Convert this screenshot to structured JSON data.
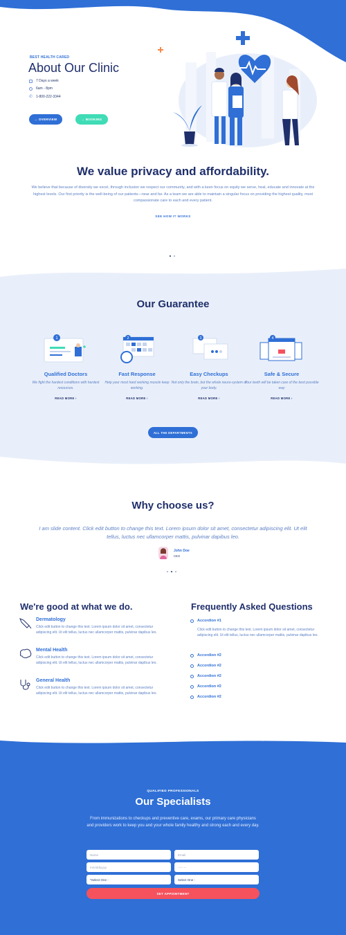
{
  "hero": {
    "eyebrow": "BEST HEALTH CARED",
    "title": "About Our Clinic",
    "info": [
      "7 Days a week",
      "6am - 8pm",
      "1-800-222-3344"
    ],
    "buttons": {
      "overview": "→ OVERVIEW",
      "booking": "→ BOOKING"
    }
  },
  "privacy": {
    "title": "We value privacy and affordability.",
    "text": "We believe that because of diversity we excel, through inclusion we respect our community, and with a keen focus on equity we serve, heal, educate and innovate at the highest levels. Our first priority is the well-being of our patients—near and far. As a team we are able to maintain a singular focus on providing the highest quality, most compassionate care to each and every patient.",
    "link": "SEE HOW IT WORKS"
  },
  "guarantee": {
    "title": "Our Guarantee",
    "cards": [
      {
        "num": "1",
        "title": "Qualified Doctors",
        "desc": "We fight the hardest conditions with hardest resources.",
        "more": "READ MORE ›"
      },
      {
        "num": "2",
        "title": "Fast Response",
        "desc": "Help your most hard working muscle keep working.",
        "more": "READ MORE ›"
      },
      {
        "num": "3",
        "title": "Easy Checkups",
        "desc": "Not only the brain, but the whole neuro-system of your body.",
        "more": "READ MORE ›"
      },
      {
        "num": "4",
        "title": "Safe & Secure",
        "desc": "Your teeth will be taken care of the best possible way",
        "more": "READ MORE ›"
      }
    ],
    "button": "ALL THE DEPARTMENTS"
  },
  "why": {
    "title": "Why choose us?",
    "quote": "I am slide content. Click edit button to change this text. Lorem ipsum dolor sit amet, consectetur adipiscing elit. Ut elit tellus, luctus nec ullamcorper mattis, pulvinar dapibus leo.",
    "person": {
      "name": "John Doe",
      "role": "CEO"
    }
  },
  "services": {
    "title": "We're good at what we do.",
    "items": [
      {
        "name": "Dermatology",
        "icon": "syringe-icon",
        "desc": "Click edit button to change this text. Lorem ipsum dolor sit amet, consectetur adipiscing elit. Ut elit tellus, luctus nec ullamcorper mattis, pulvinar dapibus leo."
      },
      {
        "name": "Mental Health",
        "icon": "brain-icon",
        "desc": "Click edit button to change this text. Lorem ipsum dolor sit amet, consectetur adipiscing elit. Ut elit tellus, luctus nec ullamcorper mattis, pulvinar dapibus leo."
      },
      {
        "name": "General Health",
        "icon": "stethoscope-icon",
        "desc": "Click edit button to change this text. Lorem ipsum dolor sit amet, consectetur adipiscing elit. Ut elit tellus, luctus nec ullamcorper mattis, pulvinar dapibus leo."
      }
    ]
  },
  "faq": {
    "title": "Frequently Asked Questions",
    "items": [
      "Accordion #1",
      "Accordion #2",
      "Accordion #2",
      "Accordion #2",
      "Accordion #2",
      "Accordion #2"
    ],
    "open_body": "Click edit button to change this text. Lorem ipsum dolor sit amet, consectetur adipiscing elit. Ut elit tellus, luctus nec ullamcorper mattis, pulvinar dapibus leo."
  },
  "specialists": {
    "eyebrow": "QUALIFIED PROFESSIONALS",
    "title": "Our Specialists",
    "text": "From immunizations to checkups and preventive care, exams, our primary care physicians and providers work to keep you and your whole family healthy and strong each and every day.",
    "form": {
      "name": "Name",
      "email": "Email",
      "date": "mm/dd/yyyy",
      "time": "--:-- --",
      "select1": "*Select One -",
      "select2": "Select One -",
      "submit": "SET APPOINTMENT"
    }
  },
  "colors": {
    "primary": "#2f6fd6",
    "navy": "#1f2f6b",
    "green": "#3fdcb6",
    "coral": "#f5525e",
    "light_bg": "#e9effa"
  }
}
